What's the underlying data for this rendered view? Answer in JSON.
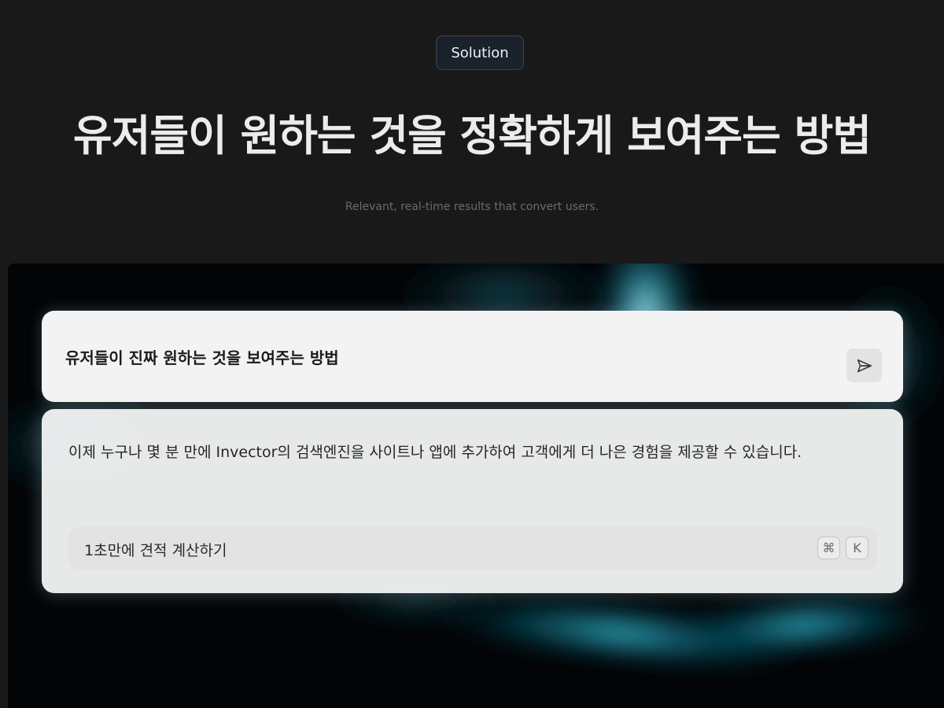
{
  "badge": {
    "label": "Solution"
  },
  "hero": {
    "title": "유저들이 원하는 것을 정확하게 보여주는 방법",
    "subtitle": "Relevant, real-time results that convert users."
  },
  "search": {
    "query": "유저들이 진짜 원하는 것을 보여주는 방법",
    "send_icon": "send-icon"
  },
  "result": {
    "text": "이제 누구나 몇 분 만에 Invector의 검색엔진을 사이트나 앱에 추가하여 고객에게 더 나은 경험을 제공할 수 있습니다.",
    "quick_action": "1초만에 견적 계산하기",
    "shortcut": {
      "modifier": "⌘",
      "key": "K"
    }
  },
  "colors": {
    "background": "#191919",
    "accent_cyan": "#19b8d6",
    "card": "#f3f3f3"
  }
}
